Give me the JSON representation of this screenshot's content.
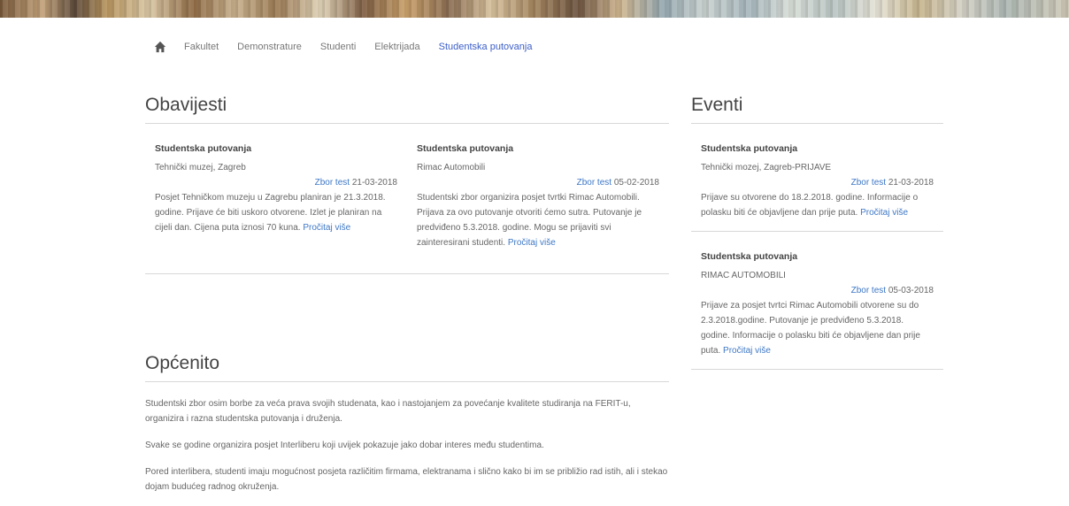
{
  "nav": {
    "home_icon": "home-icon",
    "items": [
      "Fakultet",
      "Demonstrature",
      "Studenti",
      "Elektrijada",
      "Studentska putovanja"
    ],
    "active": "Studentska putovanja",
    "active_color": "#3b5ec8"
  },
  "obavijesti": {
    "title": "Obavijesti",
    "cards": [
      {
        "category": "Studentska putovanja",
        "subtitle": "Tehnički muzej, Zagreb",
        "author": "Zbor test",
        "date": "21-03-2018",
        "body": "Posjet Tehničkom muzeju u Zagrebu planiran je 21.3.2018. godine. Prijave će biti uskoro otvorene. Izlet je planiran na cijeli dan. Cijena puta iznosi 70 kuna.",
        "more": "Pročitaj više"
      },
      {
        "category": "Studentska putovanja",
        "subtitle": "Rimac Automobili",
        "author": "Zbor test",
        "date": "05-02-2018",
        "body": "Studentski zbor organizira posjet tvrtki Rimac Automobili. Prijava za ovo putovanje otvoriti ćemo sutra. Putovanje je predviđeno 5.3.2018. godine. Mogu se prijaviti svi zainteresirani studenti.",
        "more": "Pročitaj više"
      }
    ]
  },
  "opcenito": {
    "title": "Općenito",
    "paragraphs": [
      "Studentski zbor osim borbe za veća prava svojih studenata, kao i nastojanjem za povećanje kvalitete studiranja na FERIT-u, organizira i razna studentska putovanja i druženja.",
      "Svake se godine organizira posjet Interliberu koji uvijek pokazuje jako dobar interes među studentima.",
      "Pored interlibera, studenti imaju mogućnost posjeta različitim firmama, elektranama i slično kako bi im se približio rad istih, ali i stekao dojam budućeg radnog okruženja."
    ]
  },
  "eventi": {
    "title": "Eventi",
    "items": [
      {
        "category": "Studentska putovanja",
        "subtitle": "Tehnički mozej, Zagreb-PRIJAVE",
        "author": "Zbor test",
        "date": "21-03-2018",
        "body": "Prijave su otvorene do 18.2.2018. godine. Informacije o polasku biti će objavljene dan prije puta.",
        "more": "Pročitaj više"
      },
      {
        "category": "Studentska putovanja",
        "subtitle": "RIMAC AUTOMOBILI",
        "author": "Zbor test",
        "date": "05-03-2018",
        "body": "Prijave za posjet tvrtci Rimac Automobili otvorene su do 2.3.2018.godine. Putovanje je predviđeno 5.3.2018. godine. Informacije o polasku biti će objavljene dan prije puta.",
        "more": "Pročitaj više"
      }
    ]
  },
  "link_color": "#3d77c6"
}
